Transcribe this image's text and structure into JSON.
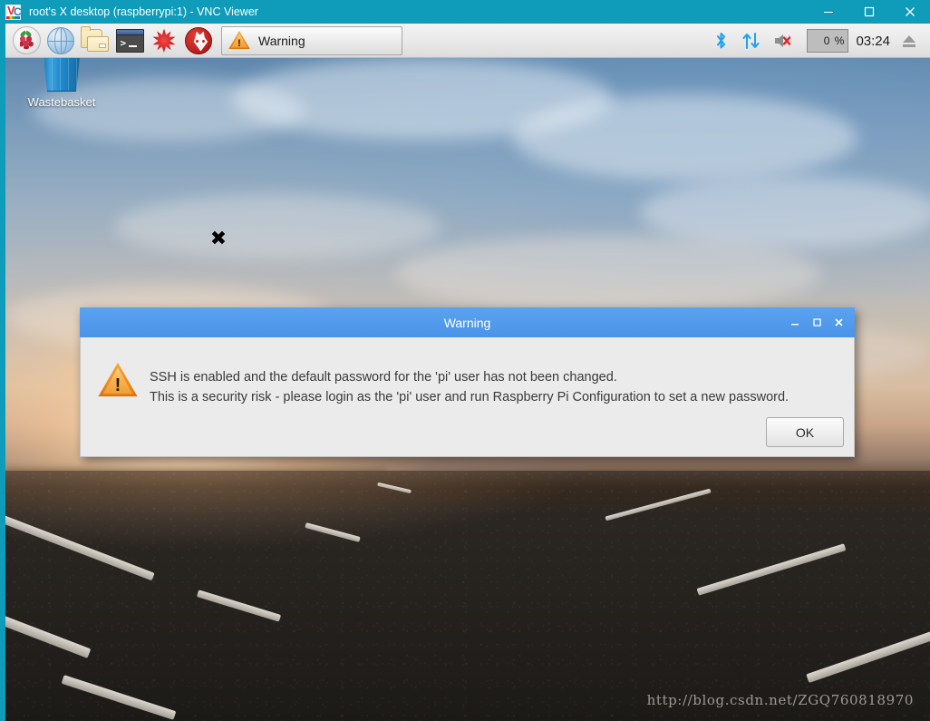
{
  "vnc_window": {
    "title": "root's X desktop (raspberrypi:1) - VNC Viewer",
    "logo": {
      "left_letter": "V",
      "right_letter": "C"
    },
    "controls": {
      "minimize": "minimize-icon",
      "maximize": "maximize-icon",
      "close": "close-icon"
    },
    "titlebar_color": "#0e9cba"
  },
  "taskbar": {
    "launchers": [
      {
        "name": "raspberry-menu-icon",
        "label": "Menu"
      },
      {
        "name": "web-browser-icon",
        "label": "Web Browser"
      },
      {
        "name": "file-manager-icon",
        "label": "File Manager"
      },
      {
        "name": "terminal-icon",
        "label": "Terminal"
      },
      {
        "name": "mathematica-icon",
        "label": "Mathematica"
      },
      {
        "name": "wolfram-icon",
        "label": "Wolfram"
      }
    ],
    "window_button": {
      "label": "Warning",
      "icon": "warning-triangle-icon"
    },
    "tray": {
      "bluetooth": "bluetooth-icon",
      "network": "network-updown-icon",
      "volume": "volume-muted-icon",
      "cpu_usage": "0 %",
      "clock": "03:24",
      "eject": "eject-icon"
    }
  },
  "desktop": {
    "icons": [
      {
        "name": "wastebasket-icon",
        "label": "Wastebasket"
      }
    ],
    "cursor": "x-cursor",
    "watermark": "http://blog.csdn.net/ZGQ760818970"
  },
  "dialog": {
    "title": "Warning",
    "icon": "warning-triangle-icon",
    "titlebar_color": "#4a93e8",
    "controls": {
      "minimize": "minimize-icon",
      "maximize": "maximize-icon",
      "close": "close-icon"
    },
    "message_lines": [
      "SSH is enabled and the default password for the 'pi' user has not been changed.",
      "This is a security risk - please login as the 'pi' user and run Raspberry Pi Configuration to set a new password."
    ],
    "ok_label": "OK"
  }
}
